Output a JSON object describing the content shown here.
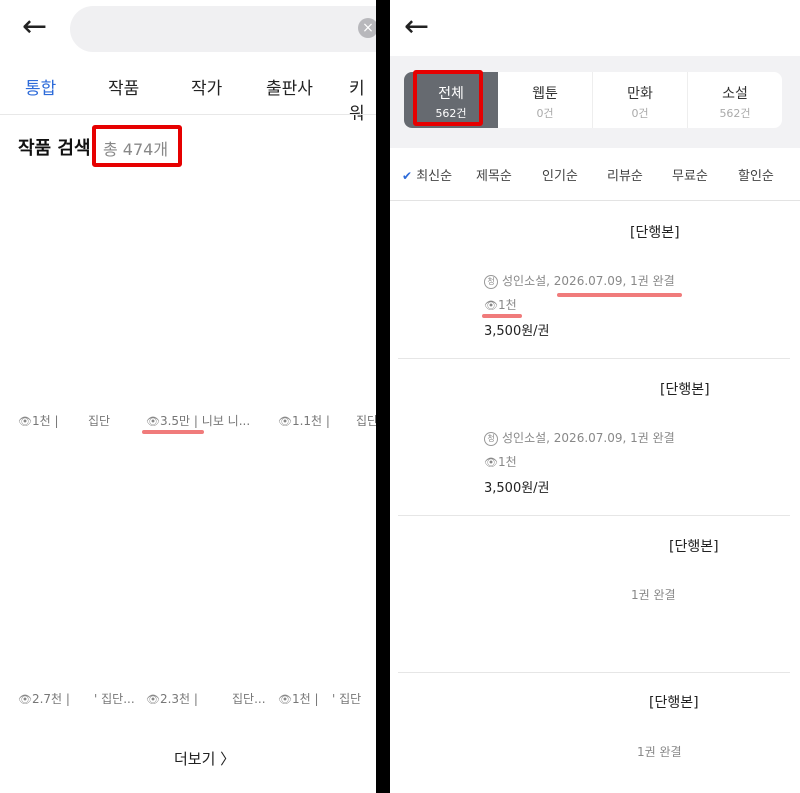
{
  "left": {
    "back_icon": "arrow-left-icon",
    "search_value": "",
    "clear_icon": "close-circle-icon",
    "tabs": [
      "통합",
      "작품",
      "작가",
      "출판사",
      "키워"
    ],
    "section_title": "작품 검색",
    "section_count": "총 474개",
    "row1": [
      {
        "views": "1천",
        "label": "|"
      },
      {
        "label": "집단"
      },
      {
        "views": "3.5만",
        "label": "| 니보 니..."
      },
      {
        "views": "1.1천",
        "label": "|"
      },
      {
        "label": "집단"
      }
    ],
    "row2": [
      {
        "views": "2.7천",
        "label": "|"
      },
      {
        "label": "' 집단..."
      },
      {
        "views": "2.3천",
        "label": "|"
      },
      {
        "label": "집단..."
      },
      {
        "views": "1천",
        "label": "|"
      },
      {
        "label": "' 집단"
      }
    ],
    "more_label": "더보기 〉"
  },
  "right": {
    "back_icon": "arrow-left-icon",
    "filters": [
      {
        "name": "전체",
        "count": "562건"
      },
      {
        "name": "웹툰",
        "count": "0건"
      },
      {
        "name": "만화",
        "count": "0건"
      },
      {
        "name": "소설",
        "count": "562건"
      }
    ],
    "sorts": [
      "최신순",
      "제목순",
      "인기순",
      "리뷰순",
      "무료순",
      "할인순"
    ],
    "items": [
      {
        "title": "[단행본]",
        "badge": "청",
        "meta": "성인소설, 2026.07.09, 1권 완결",
        "views": "1천",
        "price": "3,500원/권"
      },
      {
        "title": "[단행본]",
        "badge": "청",
        "meta": "성인소설, 2026.07.09, 1권 완결",
        "views": "1천",
        "price": "3,500원/권"
      },
      {
        "title": "[단행본]",
        "meta": "1권 완결"
      },
      {
        "title": "[단행본]",
        "meta": "1권 완결"
      }
    ]
  },
  "colors": {
    "accent": "#2d6bd9",
    "highlight": "#e60000",
    "underline": "#f07b7b"
  }
}
